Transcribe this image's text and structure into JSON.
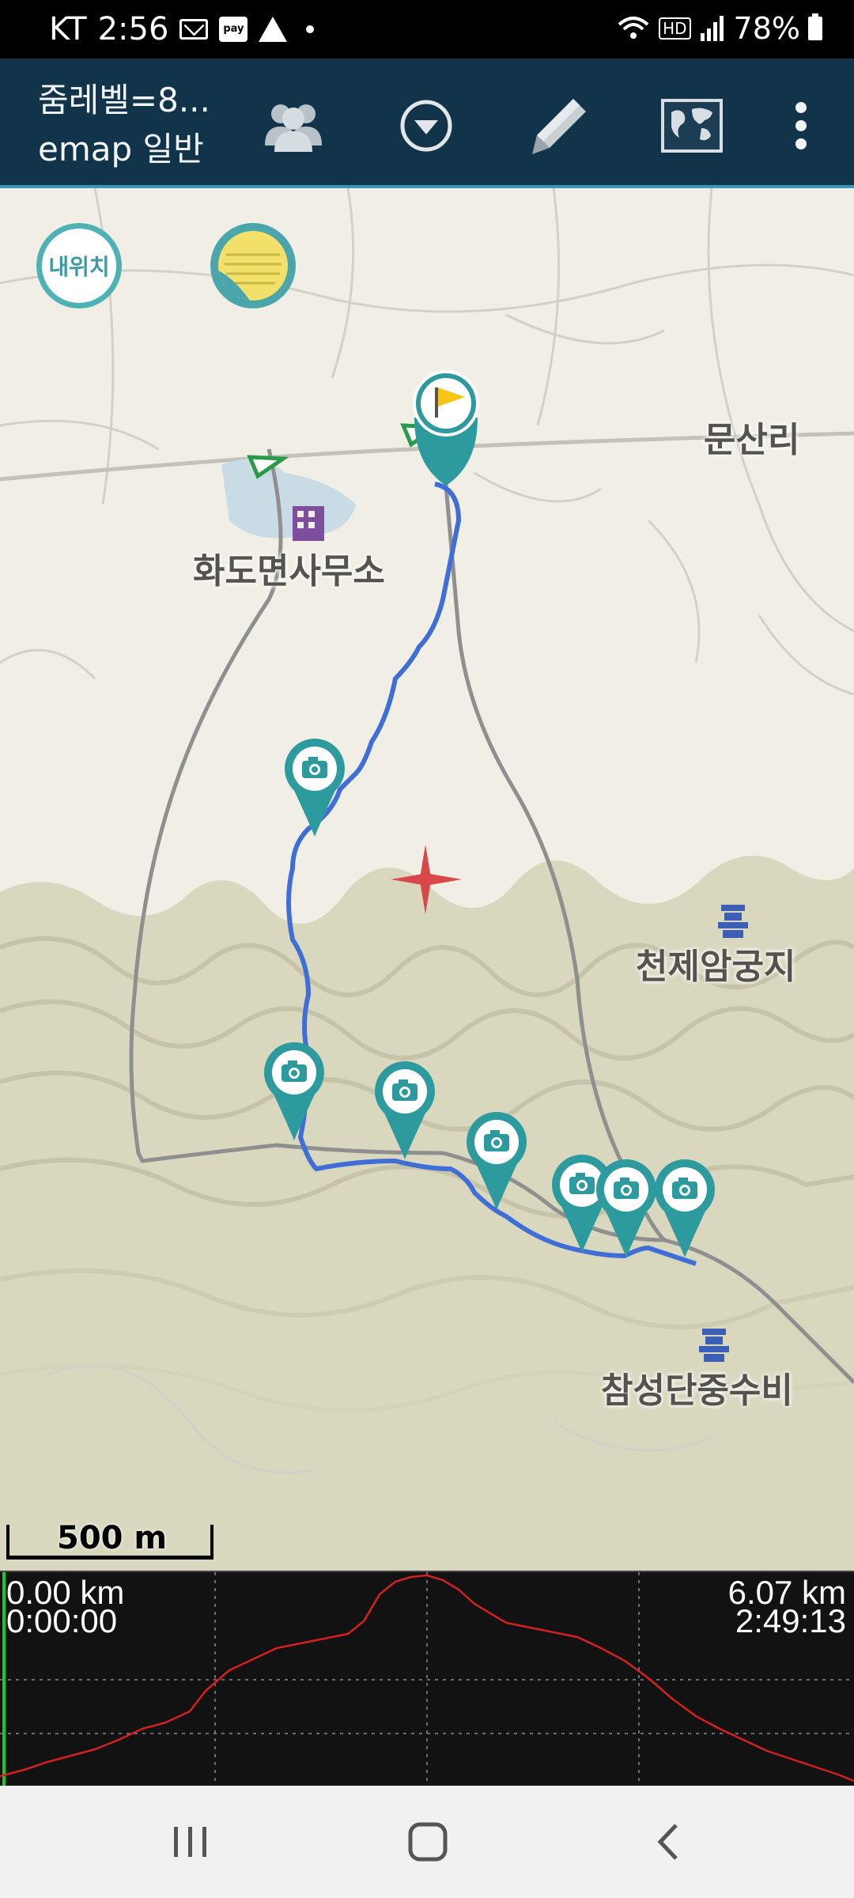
{
  "status_bar": {
    "carrier": "KT",
    "time": "2:56",
    "battery": "78%",
    "hd_label": "HD",
    "pay_label": "pay"
  },
  "toolbar": {
    "title_line1": "줌레벨=8...",
    "title_line2": "emap 일반",
    "icons": [
      "people-icon",
      "dropdown-circle-icon",
      "pencil-icon",
      "world-map-icon",
      "more-vert-icon"
    ]
  },
  "map": {
    "my_location_label": "내위치",
    "labels": {
      "office": "화도면사무소",
      "village": "문산리",
      "site1": "천제암궁지",
      "site2": "참성단중수비"
    },
    "scale_label": "500 m",
    "colors": {
      "background": "#f1eee6",
      "terrain": "#d9d6bd",
      "track": "#3f6fd6",
      "marker": "#2d9a9e",
      "road": "#8a8a8a"
    },
    "photo_marker_count": 7
  },
  "elevation": {
    "start_distance": "0.00 km",
    "start_time": "0:00:00",
    "end_distance": "6.07 km",
    "end_time": "2:49:13",
    "line_color": "#d42020"
  },
  "navbar": {
    "icons": [
      "recent-apps-icon",
      "home-icon",
      "back-icon"
    ]
  }
}
